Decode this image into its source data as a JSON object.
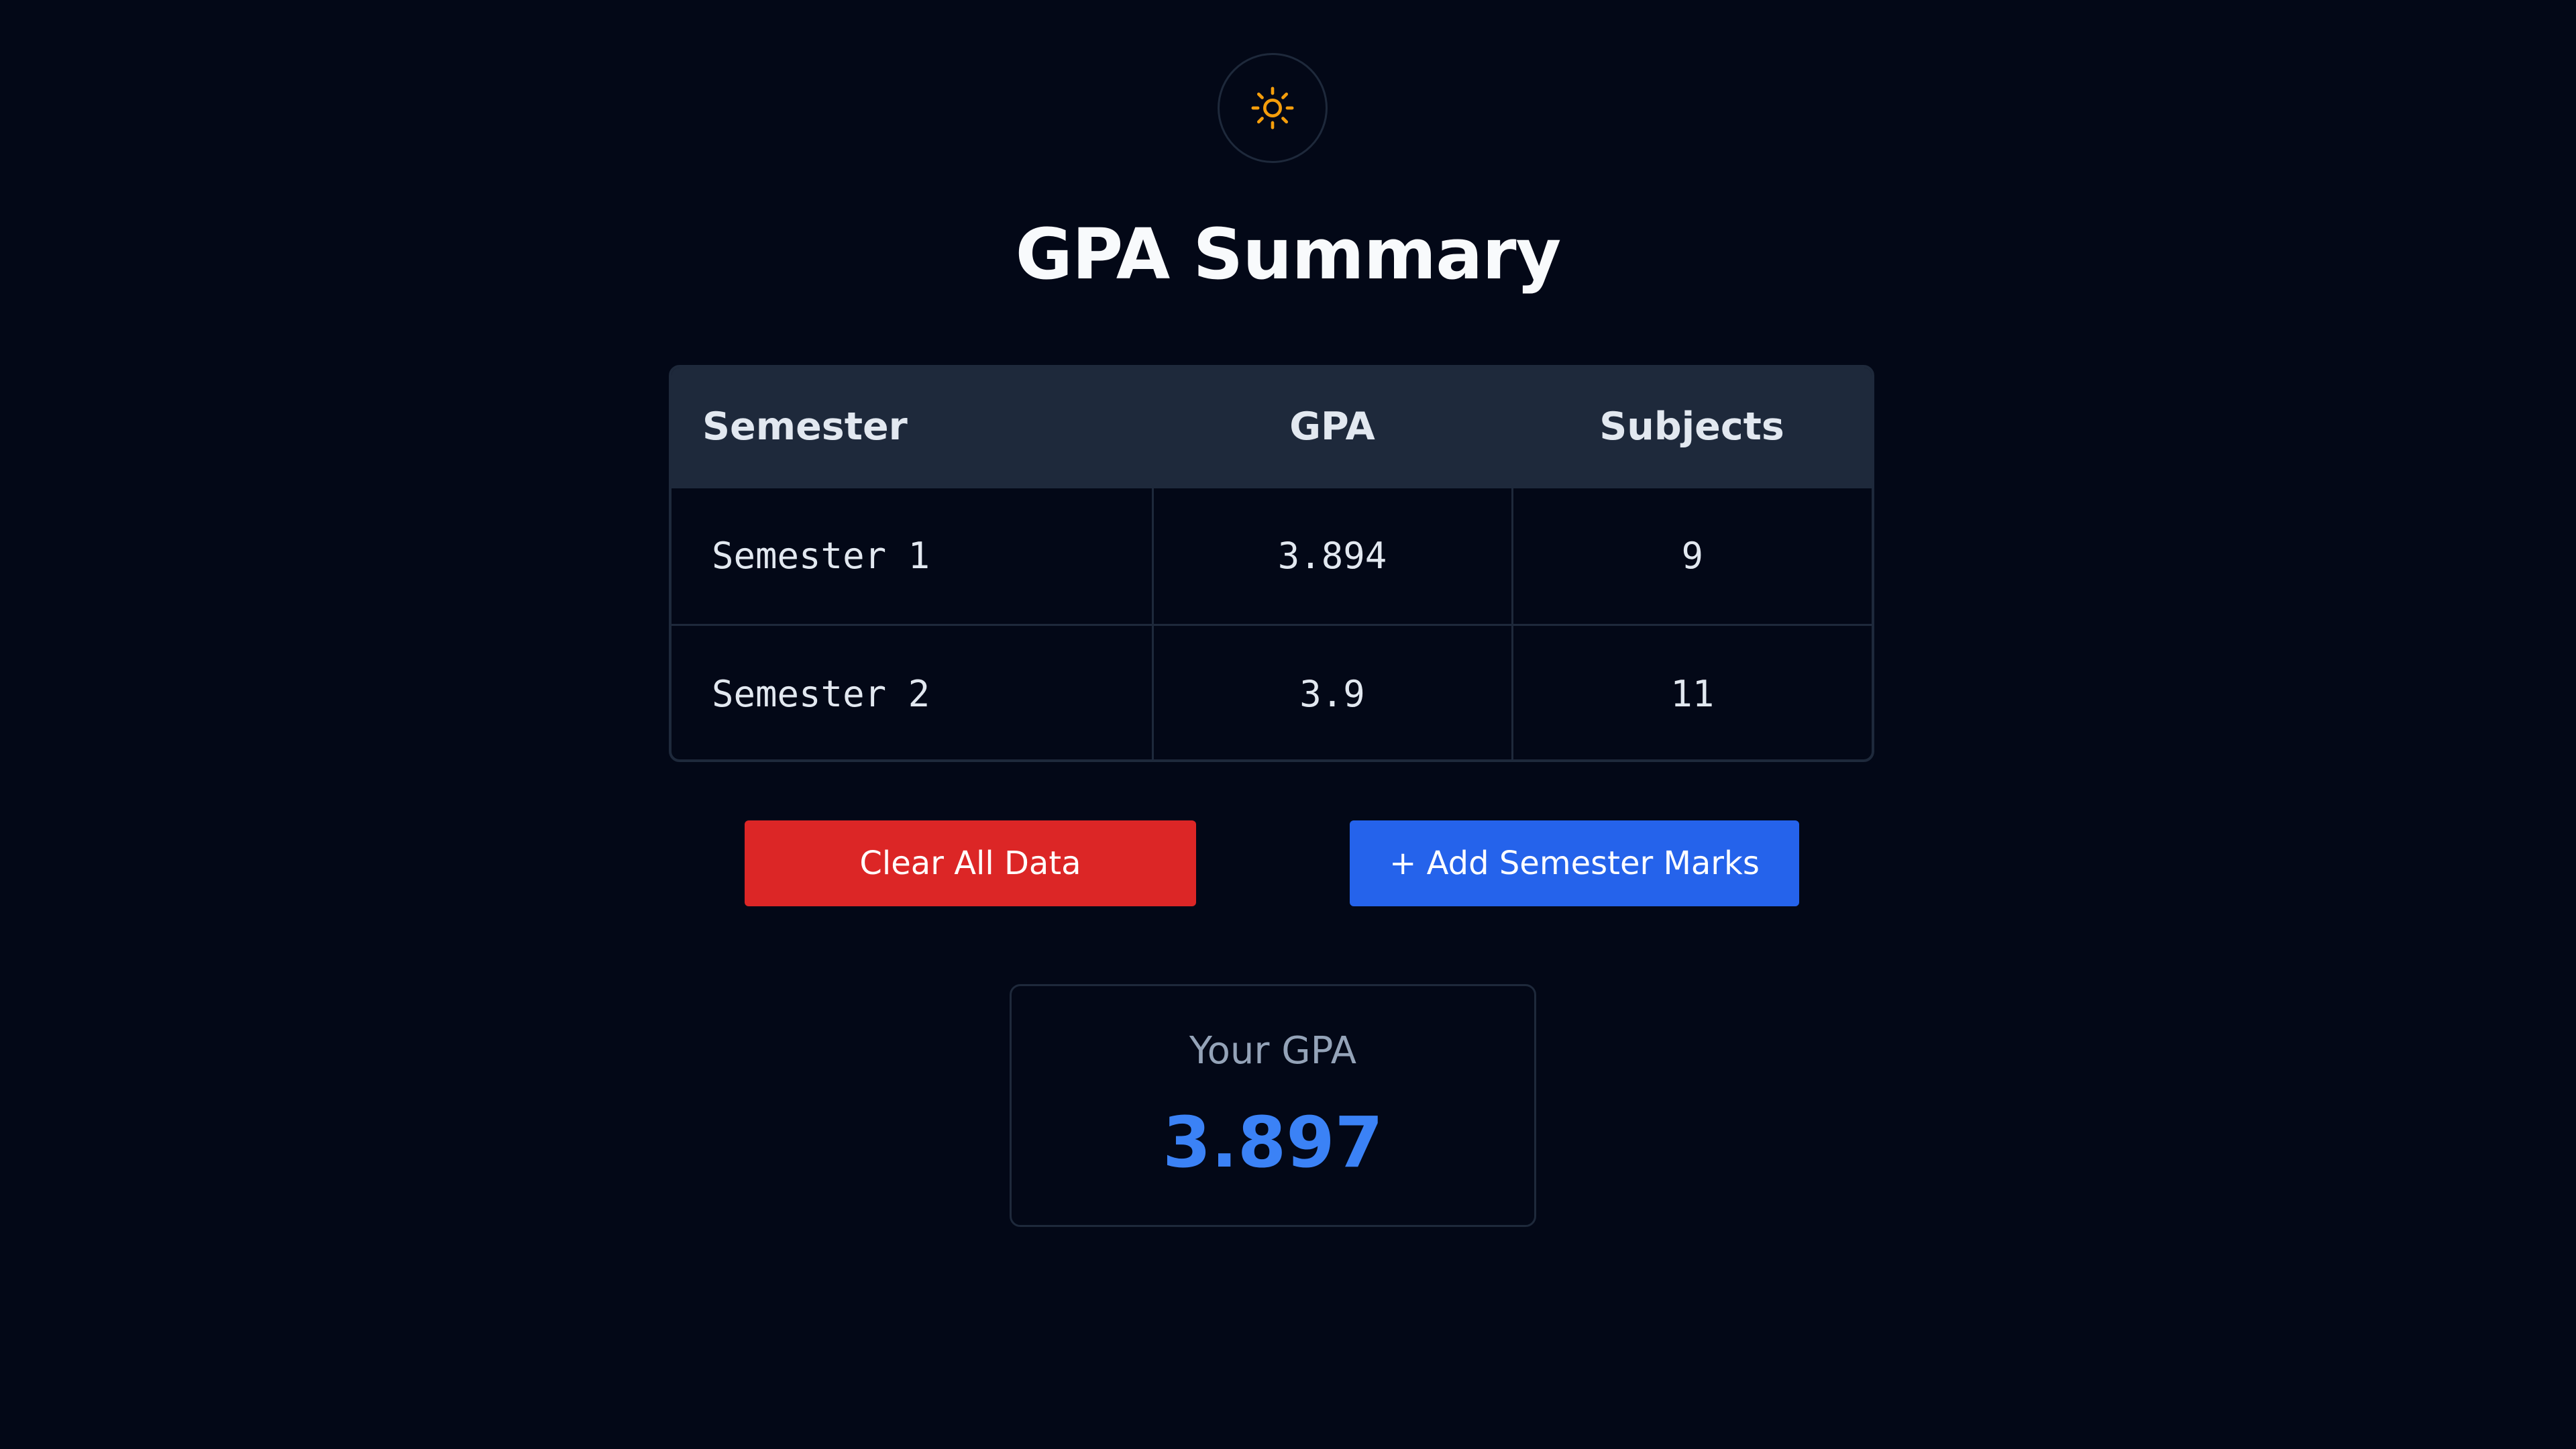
{
  "theme_toggle": {
    "icon": "sun-icon",
    "icon_color": "#f59e0b"
  },
  "title": "GPA Summary",
  "table": {
    "headers": {
      "semester": "Semester",
      "gpa": "GPA",
      "subjects": "Subjects"
    },
    "rows": [
      {
        "semester": "Semester 1",
        "gpa": "3.894",
        "subjects": "9"
      },
      {
        "semester": "Semester 2",
        "gpa": "3.9",
        "subjects": "11"
      }
    ]
  },
  "actions": {
    "clear_label": "Clear All Data",
    "clear_color": "#dc2626",
    "add_label": "+ Add Semester Marks",
    "add_color": "#2563eb"
  },
  "summary": {
    "label": "Your GPA",
    "value": "3.897",
    "value_color": "#3b82f6"
  }
}
